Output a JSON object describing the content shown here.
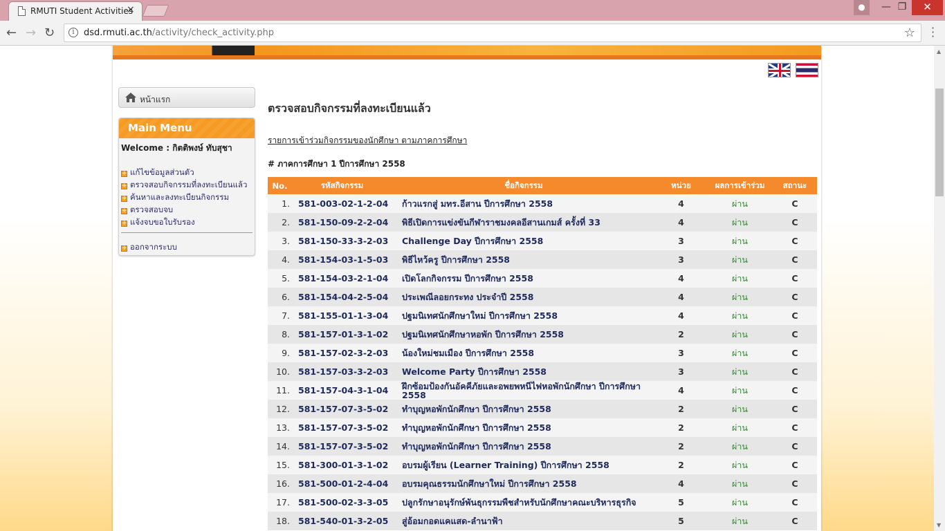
{
  "browser": {
    "tab_title": "RMUTI Student Activities",
    "tab_close": "×",
    "url_host": "dsd.rmuti.ac.th",
    "url_path": "/activity/check_activity.php"
  },
  "colors": {
    "accent": "#f48a2c",
    "titlebar": "#d8a3ad",
    "pass": "#2f8a2f"
  },
  "sidebar": {
    "home_label": "หน้าแรก",
    "menu_title": "Main Menu",
    "welcome": "Welcome : กิตติพงษ์ ทับสุชา",
    "items": [
      {
        "label": "แก้ไขข้อมูลส่วนตัว"
      },
      {
        "label": "ตรวจสอบกิจกรรมที่ลงทะเบียนแล้ว"
      },
      {
        "label": "ค้นหาและลงทะเบียนกิจกรรม"
      },
      {
        "label": "ตรวจสอบจบ"
      },
      {
        "label": "แจ้งจบขอใบรับรอง"
      }
    ],
    "logout": "ออกจากระบบ"
  },
  "main": {
    "title": "ตรวจสอบกิจกรรมที่ลงทะเบียนแล้ว",
    "subtitle_link": "รายการเข้าร่วมกิจกรรมของนักศึกษา ตามภาคการศึกษา",
    "semester_heading": "# ภาคการศึกษา 1 ปีการศึกษา 2558",
    "table": {
      "headers": [
        "No.",
        "รหัสกิจกรรม",
        "ชื่อกิจกรรม",
        "หน่วย",
        "ผลการเข้าร่วม",
        "สถานะ"
      ],
      "rows": [
        [
          "1.",
          "581-003-02-1-2-04",
          "ก้าวแรกสู่ มทร.อีสาน ปีการศึกษา 2558",
          "4",
          "ผ่าน",
          "C"
        ],
        [
          "2.",
          "581-150-09-2-2-04",
          "พิธีเปิดการแข่งขันกีฬาราชมงคลอีสานเกมส์ ครั้งที่ 33",
          "4",
          "ผ่าน",
          "C"
        ],
        [
          "3.",
          "581-150-33-3-2-03",
          "Challenge Day ปีการศึกษา 2558",
          "3",
          "ผ่าน",
          "C"
        ],
        [
          "4.",
          "581-154-03-1-5-03",
          "พิธีไหว้ครู ปีการศึกษา 2558",
          "3",
          "ผ่าน",
          "C"
        ],
        [
          "5.",
          "581-154-03-2-1-04",
          "เปิดโลกกิจกรรม ปีการศึกษา 2558",
          "4",
          "ผ่าน",
          "C"
        ],
        [
          "6.",
          "581-154-04-2-5-04",
          "ประเพณีลอยกระทง ประจำปี 2558",
          "4",
          "ผ่าน",
          "C"
        ],
        [
          "7.",
          "581-155-01-1-3-04",
          "ปฐมนิเทศนักศึกษาใหม่ ปีการศึกษา 2558",
          "4",
          "ผ่าน",
          "C"
        ],
        [
          "8.",
          "581-157-01-3-1-02",
          "ปฐมนิเทศนักศึกษาหอพัก ปีการศึกษา 2558",
          "2",
          "ผ่าน",
          "C"
        ],
        [
          "9.",
          "581-157-02-3-2-03",
          "น้องใหม่ชมเมือง ปีการศึกษา 2558",
          "3",
          "ผ่าน",
          "C"
        ],
        [
          "10.",
          "581-157-03-3-2-03",
          "Welcome Party ปีการศึกษา 2558",
          "3",
          "ผ่าน",
          "C"
        ],
        [
          "11.",
          "581-157-04-3-1-04",
          "ฝึกซ้อมป้องกันอัคคีภัยและอพยพหนีไฟหอพักนักศึกษา ปีการศึกษา 2558",
          "4",
          "ผ่าน",
          "C"
        ],
        [
          "12.",
          "581-157-07-3-5-02",
          "ทำบุญหอพักนักศึกษา ปีการศึกษา 2558",
          "2",
          "ผ่าน",
          "C"
        ],
        [
          "13.",
          "581-157-07-3-5-02",
          "ทำบุญหอพักนักศึกษา ปีการศึกษา 2558",
          "2",
          "ผ่าน",
          "C"
        ],
        [
          "14.",
          "581-157-07-3-5-02",
          "ทำบุญหอพักนักศึกษา ปีการศึกษา 2558",
          "2",
          "ผ่าน",
          "C"
        ],
        [
          "15.",
          "581-300-01-3-1-02",
          "อบรมผู้เรียน (Learner Training) ปีการศึกษา 2558",
          "2",
          "ผ่าน",
          "C"
        ],
        [
          "16.",
          "581-500-01-2-4-04",
          "อบรมคุณธรรมนักศึกษาใหม่ ปีการศึกษา 2558",
          "4",
          "ผ่าน",
          "C"
        ],
        [
          "17.",
          "581-500-02-3-3-05",
          "ปลูกรักษาอนุรักษ์พันธุกรรมพืชสำหรับนักศึกษาคณะบริหารธุรกิจ",
          "5",
          "ผ่าน",
          "C"
        ],
        [
          "18.",
          "581-540-01-3-2-05",
          "สู่อ้อมกอดแคแสด-ลำนาฟ้า",
          "5",
          "ผ่าน",
          "C"
        ]
      ]
    }
  }
}
